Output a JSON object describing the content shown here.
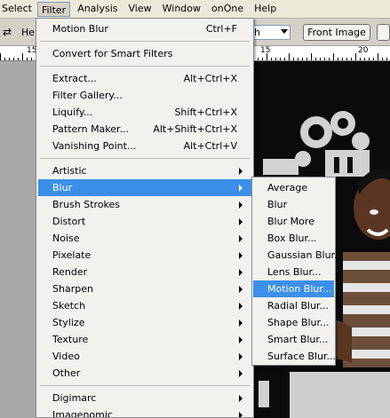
{
  "menubar": {
    "items": [
      {
        "label": "Select",
        "active": false
      },
      {
        "label": "Filter",
        "active": true
      },
      {
        "label": "Analysis",
        "active": false
      },
      {
        "label": "View",
        "active": false
      },
      {
        "label": "Window",
        "active": false
      },
      {
        "label": "onOne",
        "active": false
      },
      {
        "label": "Help",
        "active": false
      }
    ]
  },
  "optionsbar": {
    "height_label": "Hei",
    "dropdown_value": "h",
    "front_image_label": "Front Image"
  },
  "ruler": {
    "numbers": [
      "15",
      "15",
      "20"
    ]
  },
  "filter_menu": {
    "items": [
      {
        "label": "Motion Blur",
        "shortcut": "Ctrl+F"
      },
      {
        "label": "Convert for Smart Filters",
        "shortcut": ""
      },
      {
        "label": "Extract...",
        "shortcut": "Alt+Ctrl+X"
      },
      {
        "label": "Filter Gallery...",
        "shortcut": ""
      },
      {
        "label": "Liquify...",
        "shortcut": "Shift+Ctrl+X"
      },
      {
        "label": "Pattern Maker...",
        "shortcut": "Alt+Shift+Ctrl+X"
      },
      {
        "label": "Vanishing Point...",
        "shortcut": "Alt+Ctrl+V"
      },
      {
        "label": "Artistic",
        "submenu": true
      },
      {
        "label": "Blur",
        "submenu": true,
        "highlighted": true
      },
      {
        "label": "Brush Strokes",
        "submenu": true
      },
      {
        "label": "Distort",
        "submenu": true
      },
      {
        "label": "Noise",
        "submenu": true
      },
      {
        "label": "Pixelate",
        "submenu": true
      },
      {
        "label": "Render",
        "submenu": true
      },
      {
        "label": "Sharpen",
        "submenu": true
      },
      {
        "label": "Sketch",
        "submenu": true
      },
      {
        "label": "Stylize",
        "submenu": true
      },
      {
        "label": "Texture",
        "submenu": true
      },
      {
        "label": "Video",
        "submenu": true
      },
      {
        "label": "Other",
        "submenu": true
      },
      {
        "label": "Digimarc",
        "submenu": true
      },
      {
        "label": "Imagenomic",
        "submenu": true
      }
    ]
  },
  "blur_submenu": {
    "items": [
      {
        "label": "Average"
      },
      {
        "label": "Blur"
      },
      {
        "label": "Blur More"
      },
      {
        "label": "Box Blur..."
      },
      {
        "label": "Gaussian Blur..."
      },
      {
        "label": "Lens Blur..."
      },
      {
        "label": "Motion Blur...",
        "highlighted": true
      },
      {
        "label": "Radial Blur..."
      },
      {
        "label": "Shape Blur..."
      },
      {
        "label": "Smart Blur..."
      },
      {
        "label": "Surface Blur..."
      }
    ]
  },
  "colors": {
    "highlight": "#3b8fe8",
    "menu_bg": "#f2f1ee",
    "menubar_bg": "#ece9d8"
  }
}
